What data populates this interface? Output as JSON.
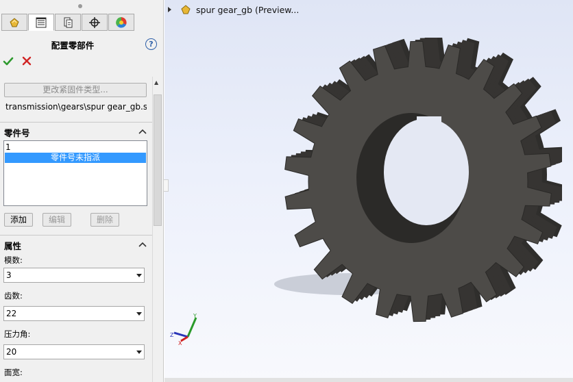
{
  "property_manager": {
    "tabs": [
      {
        "icon": "feature-manager-icon"
      },
      {
        "icon": "property-manager-icon",
        "active": true
      },
      {
        "icon": "configuration-manager-icon"
      },
      {
        "icon": "dimxpert-manager-icon"
      },
      {
        "icon": "display-manager-icon"
      }
    ],
    "title": "配置零部件",
    "help_icon": "?",
    "change_fastener_label": "更改紧固件类型...",
    "part_path": "transmission\\gears\\spur gear_gb.sldprt"
  },
  "part_number_section": {
    "title": "零件号",
    "list_first": "1",
    "list_selected": "零件号未指派",
    "add_label": "添加",
    "edit_label": "编辑",
    "delete_label": "删除"
  },
  "properties_section": {
    "title": "属性",
    "module_label": "模数:",
    "module_value": "3",
    "teeth_label": "齿数:",
    "teeth_value": "22",
    "pressure_angle_label": "压力角:",
    "pressure_angle_value": "20",
    "face_width_label": "面宽:"
  },
  "graphics_area": {
    "tree_item": "spur gear_gb   (Preview..."
  },
  "colors": {
    "selection": "#3399ff",
    "ok_green": "#2e9a2e",
    "cancel_red": "#d02424",
    "gear_face": "#4d4b48",
    "gear_side": "#2f2e2c"
  }
}
